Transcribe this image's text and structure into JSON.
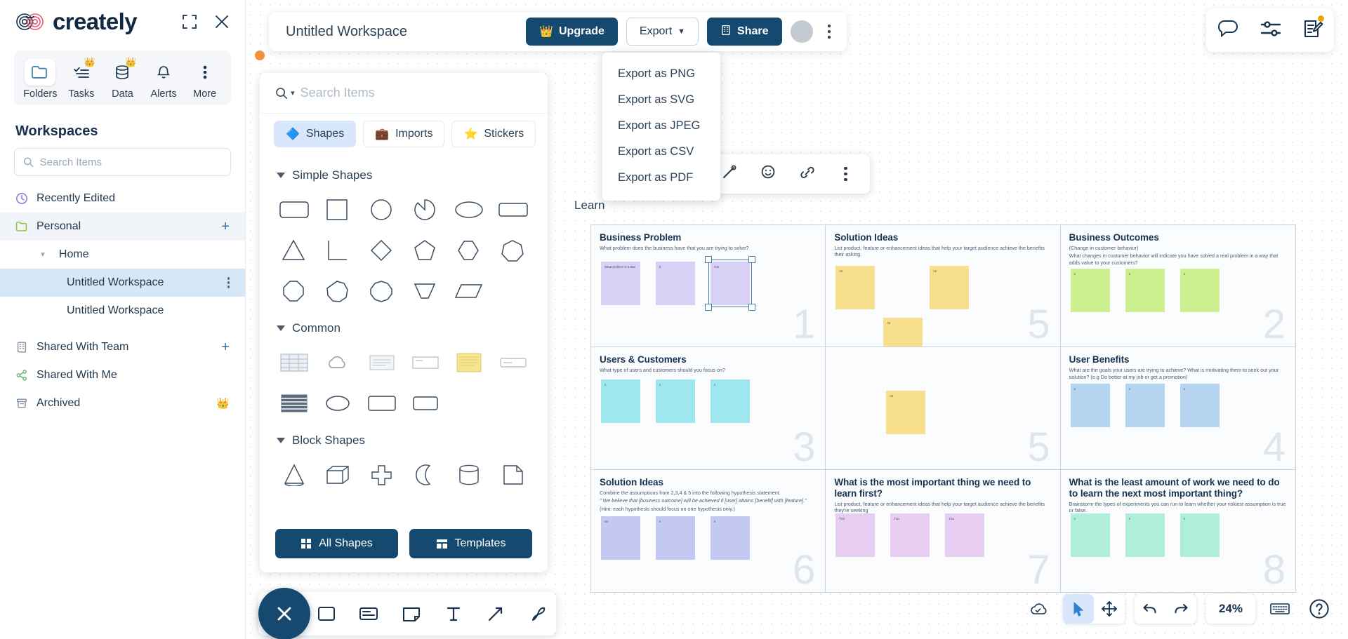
{
  "brand": {
    "name": "creately",
    "accent": "#16496f",
    "logo_icon": "creately-infinity-logo"
  },
  "sidebar": {
    "window_controls": [
      {
        "name": "expand-icon",
        "label": "expand"
      },
      {
        "name": "close-icon",
        "label": "close"
      }
    ],
    "tools": [
      {
        "label": "Folders",
        "icon": "folder-icon",
        "active": true,
        "premium": false
      },
      {
        "label": "Tasks",
        "icon": "tasks-icon",
        "active": false,
        "premium": true
      },
      {
        "label": "Data",
        "icon": "database-icon",
        "active": false,
        "premium": true
      },
      {
        "label": "Alerts",
        "icon": "bell-icon",
        "active": false,
        "premium": false
      },
      {
        "label": "More",
        "icon": "more-vertical-icon",
        "active": false,
        "premium": false
      }
    ],
    "section_title": "Workspaces",
    "search": {
      "placeholder": "Search Items",
      "value": "",
      "icon": "search-icon"
    },
    "nav": [
      {
        "label": "Recently Edited",
        "icon": "clock-icon",
        "state": "normal",
        "trailing": "none"
      },
      {
        "label": "Personal",
        "icon": "folder-green-icon",
        "state": "selected",
        "trailing": "plus"
      },
      {
        "label": "Home",
        "icon": "caret-down-icon",
        "state": "child",
        "trailing": "none"
      },
      {
        "label": "Untitled Workspace",
        "icon": "none",
        "state": "highlight",
        "trailing": "kebab"
      },
      {
        "label": "Untitled Workspace",
        "icon": "none",
        "state": "sub",
        "trailing": "none"
      },
      {
        "label": "Shared With Team",
        "icon": "building-icon",
        "state": "normal",
        "trailing": "plus"
      },
      {
        "label": "Shared With Me",
        "icon": "share-nodes-icon",
        "state": "normal",
        "trailing": "none"
      },
      {
        "label": "Archived",
        "icon": "archive-icon",
        "state": "normal",
        "trailing": "crown"
      }
    ]
  },
  "appbar": {
    "workspace_title": "Untitled Workspace",
    "upgrade_label": "Upgrade",
    "upgrade_icon": "crown-icon",
    "export_label": "Export",
    "export_caret": "▼",
    "share_label": "Share",
    "share_icon": "building-icon",
    "avatar": "user-avatar",
    "menu_icon": "kebab-menu-icon"
  },
  "export_menu": {
    "items": [
      "Export as PNG",
      "Export as SVG",
      "Export as JPEG",
      "Export as CSV",
      "Export as PDF"
    ]
  },
  "shapes_panel": {
    "search": {
      "placeholder": "Search Items",
      "value": "",
      "icon": "search-icon",
      "caret": "▾"
    },
    "tabs": [
      {
        "label": "Shapes",
        "icon": "blue-diamond-icon",
        "active": true
      },
      {
        "label": "Imports",
        "icon": "briefcase-icon",
        "active": false
      },
      {
        "label": "Stickers",
        "icon": "star-icon",
        "active": false
      }
    ],
    "groups": [
      {
        "title": "Simple Shapes",
        "expanded": true,
        "shapes": [
          "rounded-rectangle",
          "square",
          "circle",
          "pie-slice",
          "ellipse",
          "rectangle-wide",
          "triangle",
          "right-triangle",
          "diamond",
          "pentagon",
          "hexagon",
          "heptagon",
          "octagon",
          "nonagon",
          "decagon",
          "trapezoid-inverted",
          "parallelogram"
        ]
      },
      {
        "title": "Common",
        "expanded": true,
        "shapes": [
          "table-shape",
          "cloud-shape",
          "document-shape",
          "note-shape",
          "sticky-note-shape",
          "card-shape",
          "list-shape",
          "oval-shape",
          "frame-shape",
          "container-shape"
        ]
      },
      {
        "title": "Block Shapes",
        "expanded": true,
        "shapes": [
          "cone-shape",
          "cube-shape",
          "cross-shape",
          "crescent-shape",
          "cylinder-shape",
          "folded-paper-shape"
        ]
      }
    ],
    "footer": [
      {
        "label": "All Shapes",
        "icon": "grid-icon"
      },
      {
        "label": "Templates",
        "icon": "template-icon"
      }
    ]
  },
  "element_toolbar": {
    "items": [
      {
        "name": "connector-icon",
        "glyph": "line"
      },
      {
        "name": "emoji-icon",
        "glyph": "smiley"
      },
      {
        "name": "link-icon",
        "glyph": "link"
      },
      {
        "name": "more-options-icon",
        "glyph": "kebab"
      }
    ]
  },
  "board": {
    "label": "Learn",
    "cells": [
      {
        "number": "1",
        "title": "Business Problem",
        "desc": "What problem does the business have that you are trying to solve?",
        "desc2": "",
        "note_color": "#d8d0f5",
        "notes": 3,
        "selected_note": 3
      },
      {
        "number": "5",
        "title": "Solution Ideas",
        "desc": "List product, feature or enhancement ideas that help your target audience achieve the benefits their asking.",
        "desc2": "",
        "note_color": "#f7df8e",
        "notes": 4,
        "selected_note": 0
      },
      {
        "number": "2",
        "title": "Business Outcomes",
        "desc": "(Change in customer behavior)",
        "desc2": "What changes in customer behavior will indicate you have solved a real problem in a way that adds value to your customers?",
        "note_color": "#ccef8f",
        "notes": 3,
        "selected_note": 0
      },
      {
        "number": "3",
        "title": "Users & Customers",
        "desc": "What type of users and customers should you focus on?",
        "desc2": "",
        "note_color": "#9fe7ef",
        "notes": 3,
        "selected_note": 0
      },
      {
        "number": "",
        "title": "",
        "desc": "",
        "desc2": "",
        "note_color": "#f7df8e",
        "notes": 0,
        "selected_note": 0
      },
      {
        "number": "4",
        "title": "User Benefits",
        "desc": "What are the goals your users are trying to achieve? What is motivating them to seek out your solution? (e.g Do better at my job or get a promotion)",
        "desc2": "",
        "note_color": "#b5d4f0",
        "notes": 3,
        "selected_note": 0
      },
      {
        "number": "6",
        "title": "Solution Ideas",
        "desc": "Combine the assumptions from 2,3,4 & 5 into the following hypothesis statement.",
        "desc2": "\" We believe that [business outcome] will be achieved if [user] attains [benefit] with [feature].\"",
        "desc3": "(Hint: each hypothesis should focus on one hypothesis only.)",
        "note_color": "#c3c9f2",
        "notes": 3,
        "selected_note": 0
      },
      {
        "number": "7",
        "title": "What is the most important thing we need to learn first?",
        "desc": "List product, feature or enhancement ideas that help your target audience achieve the benefits they're seeking",
        "desc2": "",
        "note_color": "#e8cdf2",
        "notes": 3,
        "selected_note": 0
      },
      {
        "number": "8",
        "title": "What is the least amount of work we need to do to learn the next most important thing?",
        "desc": "Brainstorm the types of experiments you can run to learn whether your riskiest assumption is true or false.",
        "desc2": "",
        "note_color": "#aeeedb",
        "notes": 3,
        "selected_note": 0
      }
    ]
  },
  "bottom_toolbar": {
    "close_icon": "close-icon",
    "items": [
      {
        "name": "shape-tool-icon"
      },
      {
        "name": "card-tool-icon"
      },
      {
        "name": "note-tool-icon"
      },
      {
        "name": "text-tool-icon"
      },
      {
        "name": "connector-tool-icon"
      },
      {
        "name": "pen-tool-icon"
      }
    ]
  },
  "bottom_right": {
    "cloud_icon": "cloud-saved-icon",
    "select_icon": "cursor-select-icon",
    "pan_icon": "pan-move-icon",
    "undo_icon": "undo-icon",
    "redo_icon": "redo-icon",
    "zoom_level": "24%",
    "keyboard_icon": "keyboard-icon",
    "help_icon": "help-circle-icon"
  },
  "top_right": {
    "comment_icon": "comment-icon",
    "filter_icon": "sliders-icon",
    "notes_icon": "edit-note-icon",
    "badge_color": "#f0a500"
  }
}
